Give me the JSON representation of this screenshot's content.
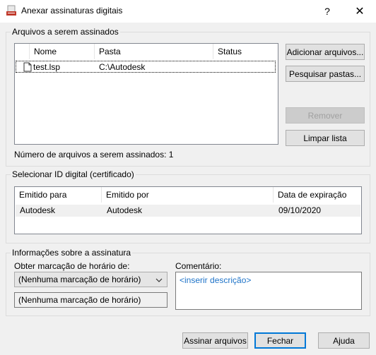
{
  "window": {
    "title": "Anexar assinaturas digitais",
    "help_glyph": "?",
    "close_glyph": "✕"
  },
  "files_group": {
    "legend": "Arquivos a serem assinados",
    "columns": [
      "Nome",
      "Pasta",
      "Status"
    ],
    "rows": [
      {
        "name": "test.lsp",
        "folder": "C:\\Autodesk",
        "status": ""
      }
    ],
    "count_label": "Número de arquivos a serem assinados: 1",
    "buttons": {
      "add_files": "Adicionar arquivos...",
      "search_folders": "Pesquisar pastas...",
      "remove": "Remover",
      "clear_list": "Limpar lista"
    }
  },
  "cert_group": {
    "legend": "Selecionar ID digital (certificado)",
    "columns": [
      "Emitido para",
      "Emitido por",
      "Data de expiração"
    ],
    "rows": [
      {
        "issued_to": "Autodesk",
        "issued_by": "Autodesk",
        "expiration": "09/10/2020"
      }
    ]
  },
  "signature_group": {
    "legend": "Informações sobre a assinatura",
    "timestamp_label": "Obter marcação de horário de:",
    "timestamp_selected": "(Nenhuma marcação de horário)",
    "timestamp_display": "(Nenhuma marcação de horário)",
    "comment_label": "Comentário:",
    "comment_placeholder": "<inserir descrição>"
  },
  "footer": {
    "sign_files": "Assinar arquivos",
    "close": "Fechar",
    "help": "Ajuda"
  },
  "colors": {
    "accent": "#0078d7",
    "selection_row": "#f0f0f0"
  }
}
